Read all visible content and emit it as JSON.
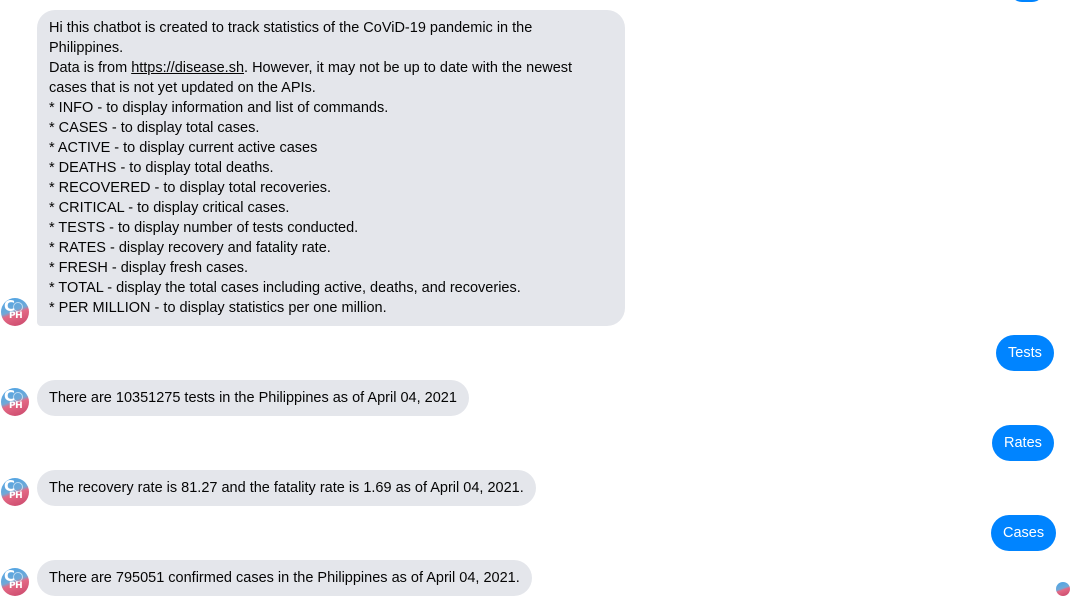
{
  "messages": {
    "intro": {
      "lines": [
        "Hi this chatbot is created to track statistics of the CoViD-19 pandemic in the",
        "Philippines.",
        "Data is from ",
        "https://disease.sh",
        ". However, it may not be up to date with the newest",
        "cases that is not yet updated on the APIs.",
        "* INFO - to display information and list of commands.",
        "* CASES - to display total cases.",
        "* ACTIVE - to display current active cases",
        "* DEATHS - to display total deaths.",
        "* RECOVERED - to display total recoveries.",
        "* CRITICAL - to display critical cases.",
        "* TESTS - to display number of tests conducted.",
        "* RATES - display recovery and fatality rate.",
        "* FRESH - display fresh cases.",
        "* TOTAL - display the total cases including active, deaths, and recoveries.",
        "* PER MILLION - to display statistics per one million."
      ]
    },
    "user_tests": "Tests",
    "bot_tests": "There are 10351275 tests in the Philippines as of April 04, 2021",
    "user_rates": "Rates",
    "bot_rates": "The recovery rate is 81.27 and the fatality rate is 1.69 as of April 04, 2021.",
    "user_cases": "Cases",
    "bot_cases": "There are 795051 confirmed cases in the Philippines as of April 04, 2021."
  },
  "bot": {
    "avatar_letter": "C",
    "avatar_sub": "PH",
    "avatar_icon": "covid-ph-bot-avatar"
  },
  "colors": {
    "incoming_bubble": "#e4e6eb",
    "outgoing_bubble": "#0084ff"
  }
}
